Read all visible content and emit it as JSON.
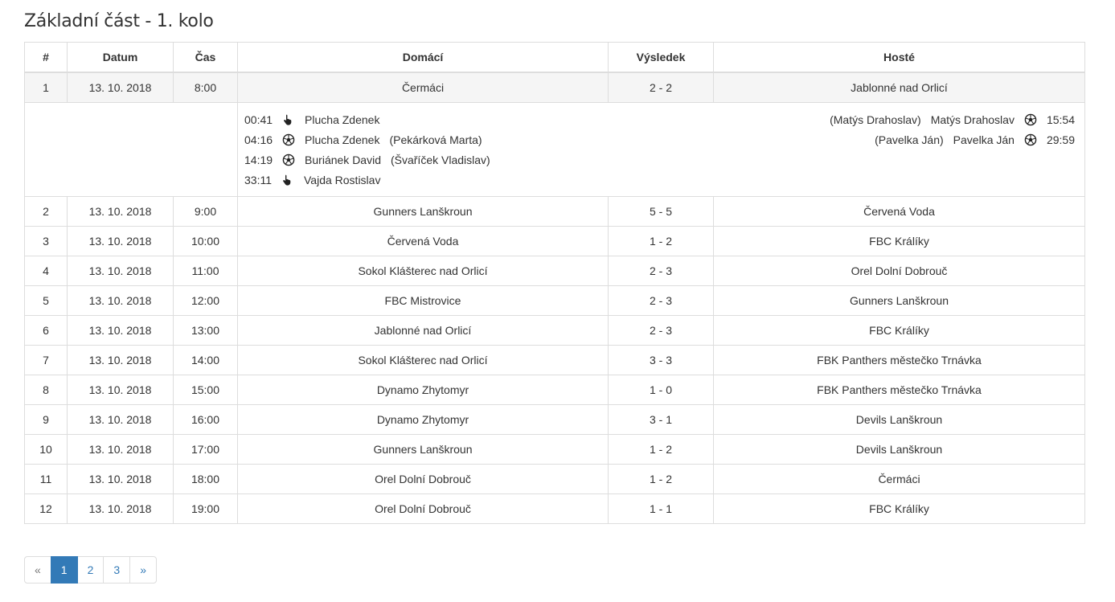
{
  "page": {
    "title": "Základní část - 1. kolo"
  },
  "table": {
    "headers": [
      "#",
      "Datum",
      "Čas",
      "Domácí",
      "Výsledek",
      "Hosté"
    ],
    "rows": [
      {
        "num": "1",
        "date": "13. 10. 2018",
        "time": "8:00",
        "home": "Čermáci",
        "score": "2 - 2",
        "away": "Jablonné nad Orlicí"
      },
      {
        "num": "2",
        "date": "13. 10. 2018",
        "time": "9:00",
        "home": "Gunners Lanškroun",
        "score": "5 - 5",
        "away": "Červená Voda"
      },
      {
        "num": "3",
        "date": "13. 10. 2018",
        "time": "10:00",
        "home": "Červená Voda",
        "score": "1 - 2",
        "away": "FBC Králíky"
      },
      {
        "num": "4",
        "date": "13. 10. 2018",
        "time": "11:00",
        "home": "Sokol Klášterec nad Orlicí",
        "score": "2 - 3",
        "away": "Orel Dolní Dobrouč"
      },
      {
        "num": "5",
        "date": "13. 10. 2018",
        "time": "12:00",
        "home": "FBC Mistrovice",
        "score": "2 - 3",
        "away": "Gunners Lanškroun"
      },
      {
        "num": "6",
        "date": "13. 10. 2018",
        "time": "13:00",
        "home": "Jablonné nad Orlicí",
        "score": "2 - 3",
        "away": "FBC Králíky"
      },
      {
        "num": "7",
        "date": "13. 10. 2018",
        "time": "14:00",
        "home": "Sokol Klášterec nad Orlicí",
        "score": "3 - 3",
        "away": "FBK Panthers městečko Trnávka"
      },
      {
        "num": "8",
        "date": "13. 10. 2018",
        "time": "15:00",
        "home": "Dynamo Zhytomyr",
        "score": "1 - 0",
        "away": "FBK Panthers městečko Trnávka"
      },
      {
        "num": "9",
        "date": "13. 10. 2018",
        "time": "16:00",
        "home": "Dynamo Zhytomyr",
        "score": "3 - 1",
        "away": "Devils Lanškroun"
      },
      {
        "num": "10",
        "date": "13. 10. 2018",
        "time": "17:00",
        "home": "Gunners Lanškroun",
        "score": "1 - 2",
        "away": "Devils Lanškroun"
      },
      {
        "num": "11",
        "date": "13. 10. 2018",
        "time": "18:00",
        "home": "Orel Dolní Dobrouč",
        "score": "1 - 2",
        "away": "Čermáci"
      },
      {
        "num": "12",
        "date": "13. 10. 2018",
        "time": "19:00",
        "home": "Orel Dolní Dobrouč",
        "score": "1 - 1",
        "away": "FBC Králíky"
      }
    ]
  },
  "events": {
    "home": [
      {
        "time": "00:41",
        "icon": "hand-pointer-icon",
        "player": "Plucha Zdenek",
        "assist": ""
      },
      {
        "time": "04:16",
        "icon": "ball-icon",
        "player": "Plucha Zdenek",
        "assist": "(Pekárková Marta)"
      },
      {
        "time": "14:19",
        "icon": "ball-icon",
        "player": "Buriánek David",
        "assist": "(Švaříček Vladislav)"
      },
      {
        "time": "33:11",
        "icon": "hand-pointer-icon",
        "player": "Vajda Rostislav",
        "assist": ""
      }
    ],
    "away": [
      {
        "time": "15:54",
        "icon": "ball-icon",
        "player": "Matýs Drahoslav",
        "assist": "(Matýs Drahoslav)"
      },
      {
        "time": "29:59",
        "icon": "ball-icon",
        "player": "Pavelka Ján",
        "assist": "(Pavelka Ján)"
      }
    ]
  },
  "pagination": {
    "prev": "«",
    "pages": [
      "1",
      "2",
      "3"
    ],
    "active": "1",
    "next": "»"
  },
  "colors": {
    "link": "#337ab7",
    "border": "#dddddd",
    "highlight": "#f5f5f5"
  }
}
